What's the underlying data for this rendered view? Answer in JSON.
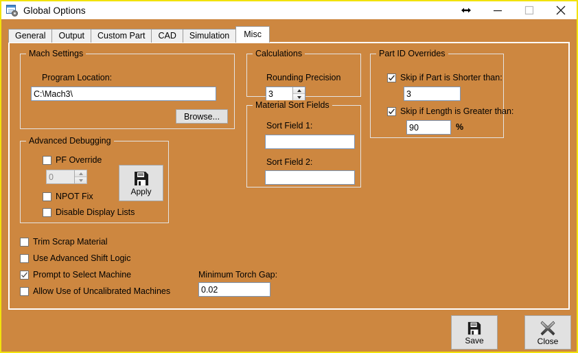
{
  "window": {
    "title": "Global Options",
    "icon": "options-form-icon",
    "border_color": "#F2E20C",
    "background_color": "#CD8740",
    "controls": [
      {
        "name": "resize-horizontal",
        "icon": "resize-horizontal-icon"
      },
      {
        "name": "minimize",
        "icon": "minimize-icon"
      },
      {
        "name": "maximize",
        "icon": "maximize-icon"
      },
      {
        "name": "close",
        "icon": "close-icon"
      }
    ]
  },
  "tabs": [
    {
      "label": "General",
      "active": false
    },
    {
      "label": "Output",
      "active": false
    },
    {
      "label": "Custom Part",
      "active": false
    },
    {
      "label": "CAD",
      "active": false
    },
    {
      "label": "Simulation",
      "active": false
    },
    {
      "label": "Misc",
      "active": true
    }
  ],
  "mach_settings": {
    "title": "Mach Settings",
    "program_location_label": "Program Location:",
    "program_location_value": "C:\\Mach3\\",
    "browse_label": "Browse..."
  },
  "advanced_debugging": {
    "title": "Advanced Debugging",
    "pf_override_label": "PF Override",
    "pf_override_checked": false,
    "pf_override_value": "0",
    "pf_override_enabled": false,
    "npot_fix_label": "NPOT Fix",
    "npot_fix_checked": false,
    "disable_display_lists_label": "Disable Display Lists",
    "disable_display_lists_checked": false,
    "apply_label": "Apply",
    "apply_icon": "floppy-save-icon"
  },
  "calculations": {
    "title": "Calculations",
    "rounding_precision_label": "Rounding Precision",
    "rounding_precision_value": "3"
  },
  "material_sort_fields": {
    "title": "Material Sort Fields",
    "sort_field_1_label": "Sort Field 1:",
    "sort_field_1_value": "",
    "sort_field_2_label": "Sort Field 2:",
    "sort_field_2_value": ""
  },
  "part_id_overrides": {
    "title": "Part ID Overrides",
    "skip_shorter_label": "Skip if Part is Shorter than:",
    "skip_shorter_checked": true,
    "skip_shorter_value": "3",
    "skip_longer_label": "Skip if Length is Greater than:",
    "skip_longer_checked": true,
    "skip_longer_value": "90",
    "percent_symbol": "%"
  },
  "options": [
    {
      "label": "Trim Scrap Material",
      "checked": false
    },
    {
      "label": "Use Advanced Shift Logic",
      "checked": false
    },
    {
      "label": "Prompt to Select Machine",
      "checked": true
    },
    {
      "label": "Allow Use of Uncalibrated Machines",
      "checked": false
    }
  ],
  "minimum_torch_gap": {
    "label": "Minimum Torch Gap:",
    "value": "0.02"
  },
  "footer": {
    "save_label": "Save",
    "save_icon": "floppy-save-icon",
    "close_label": "Close",
    "close_icon": "x-close-icon"
  }
}
